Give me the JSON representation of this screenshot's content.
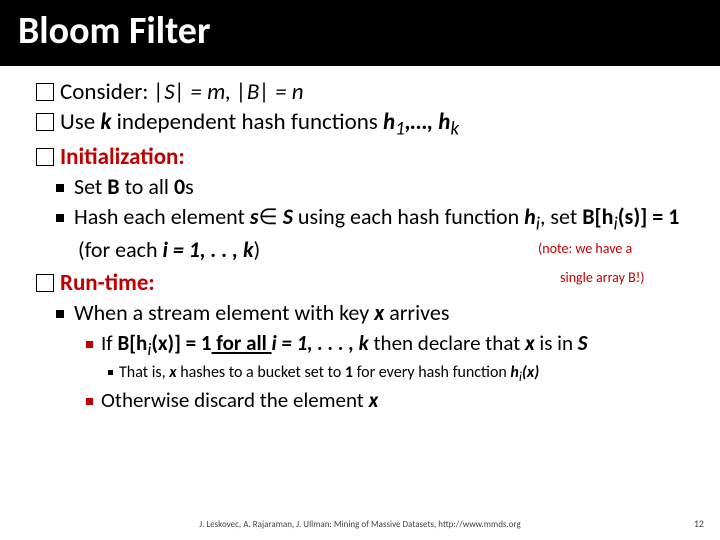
{
  "title": "Bloom Filter",
  "line1": {
    "prefix": "Consider: ",
    "rest": "|S| = m, |B| = n"
  },
  "line2": {
    "prefix": "Use ",
    "mid": " independent hash functions ",
    "k": "k",
    "hs": "h",
    "one": "1",
    "dots": ",…, ",
    "hk": "h",
    "ksub": "k"
  },
  "line3": "Initialization:",
  "sub_a": {
    "pre": "Set ",
    "b": "B",
    "mid": " to all ",
    "zero": "0",
    "s": "s"
  },
  "sub_b": {
    "pre": "Hash each element ",
    "s": "s",
    "in": "∈",
    "S": "S",
    "mid": " using each hash function ",
    "h": "h",
    "i": "i",
    "comma": ", set ",
    "bh": "B[h",
    "isub": "i",
    "sarg": "(s)] = 1",
    "for": "   (for each ",
    "ieq": "i = 1, . . , k",
    "close": ")"
  },
  "note1": "(note: we have a",
  "note2": "single array B!)",
  "line4": "Run-time:",
  "sub_c": {
    "pre": "When a stream element with key ",
    "x": "x",
    "post": " arrives"
  },
  "sub_d": {
    "pre": "If ",
    "bh": "B[h",
    "i": "i",
    "xarg": "(x)] = 1",
    "forall": " for all ",
    "ieq": "i = 1, . . . , k",
    "then": " then declare that ",
    "x": "x",
    "isin": " is in ",
    "S": "S"
  },
  "sub_e": {
    "pre": "That is, ",
    "x1": "x",
    "mid": " hashes to a bucket set to ",
    "one": "1",
    "mid2": " for every hash function ",
    "h": "h",
    "i": "i",
    "xarg": "(x)"
  },
  "sub_f": {
    "pre": "Otherwise discard the element ",
    "x": "x"
  },
  "footer": "J. Leskovec, A. Rajaraman, J. Ullman: Mining of Massive Datasets, http://www.mmds.org",
  "page": "12"
}
